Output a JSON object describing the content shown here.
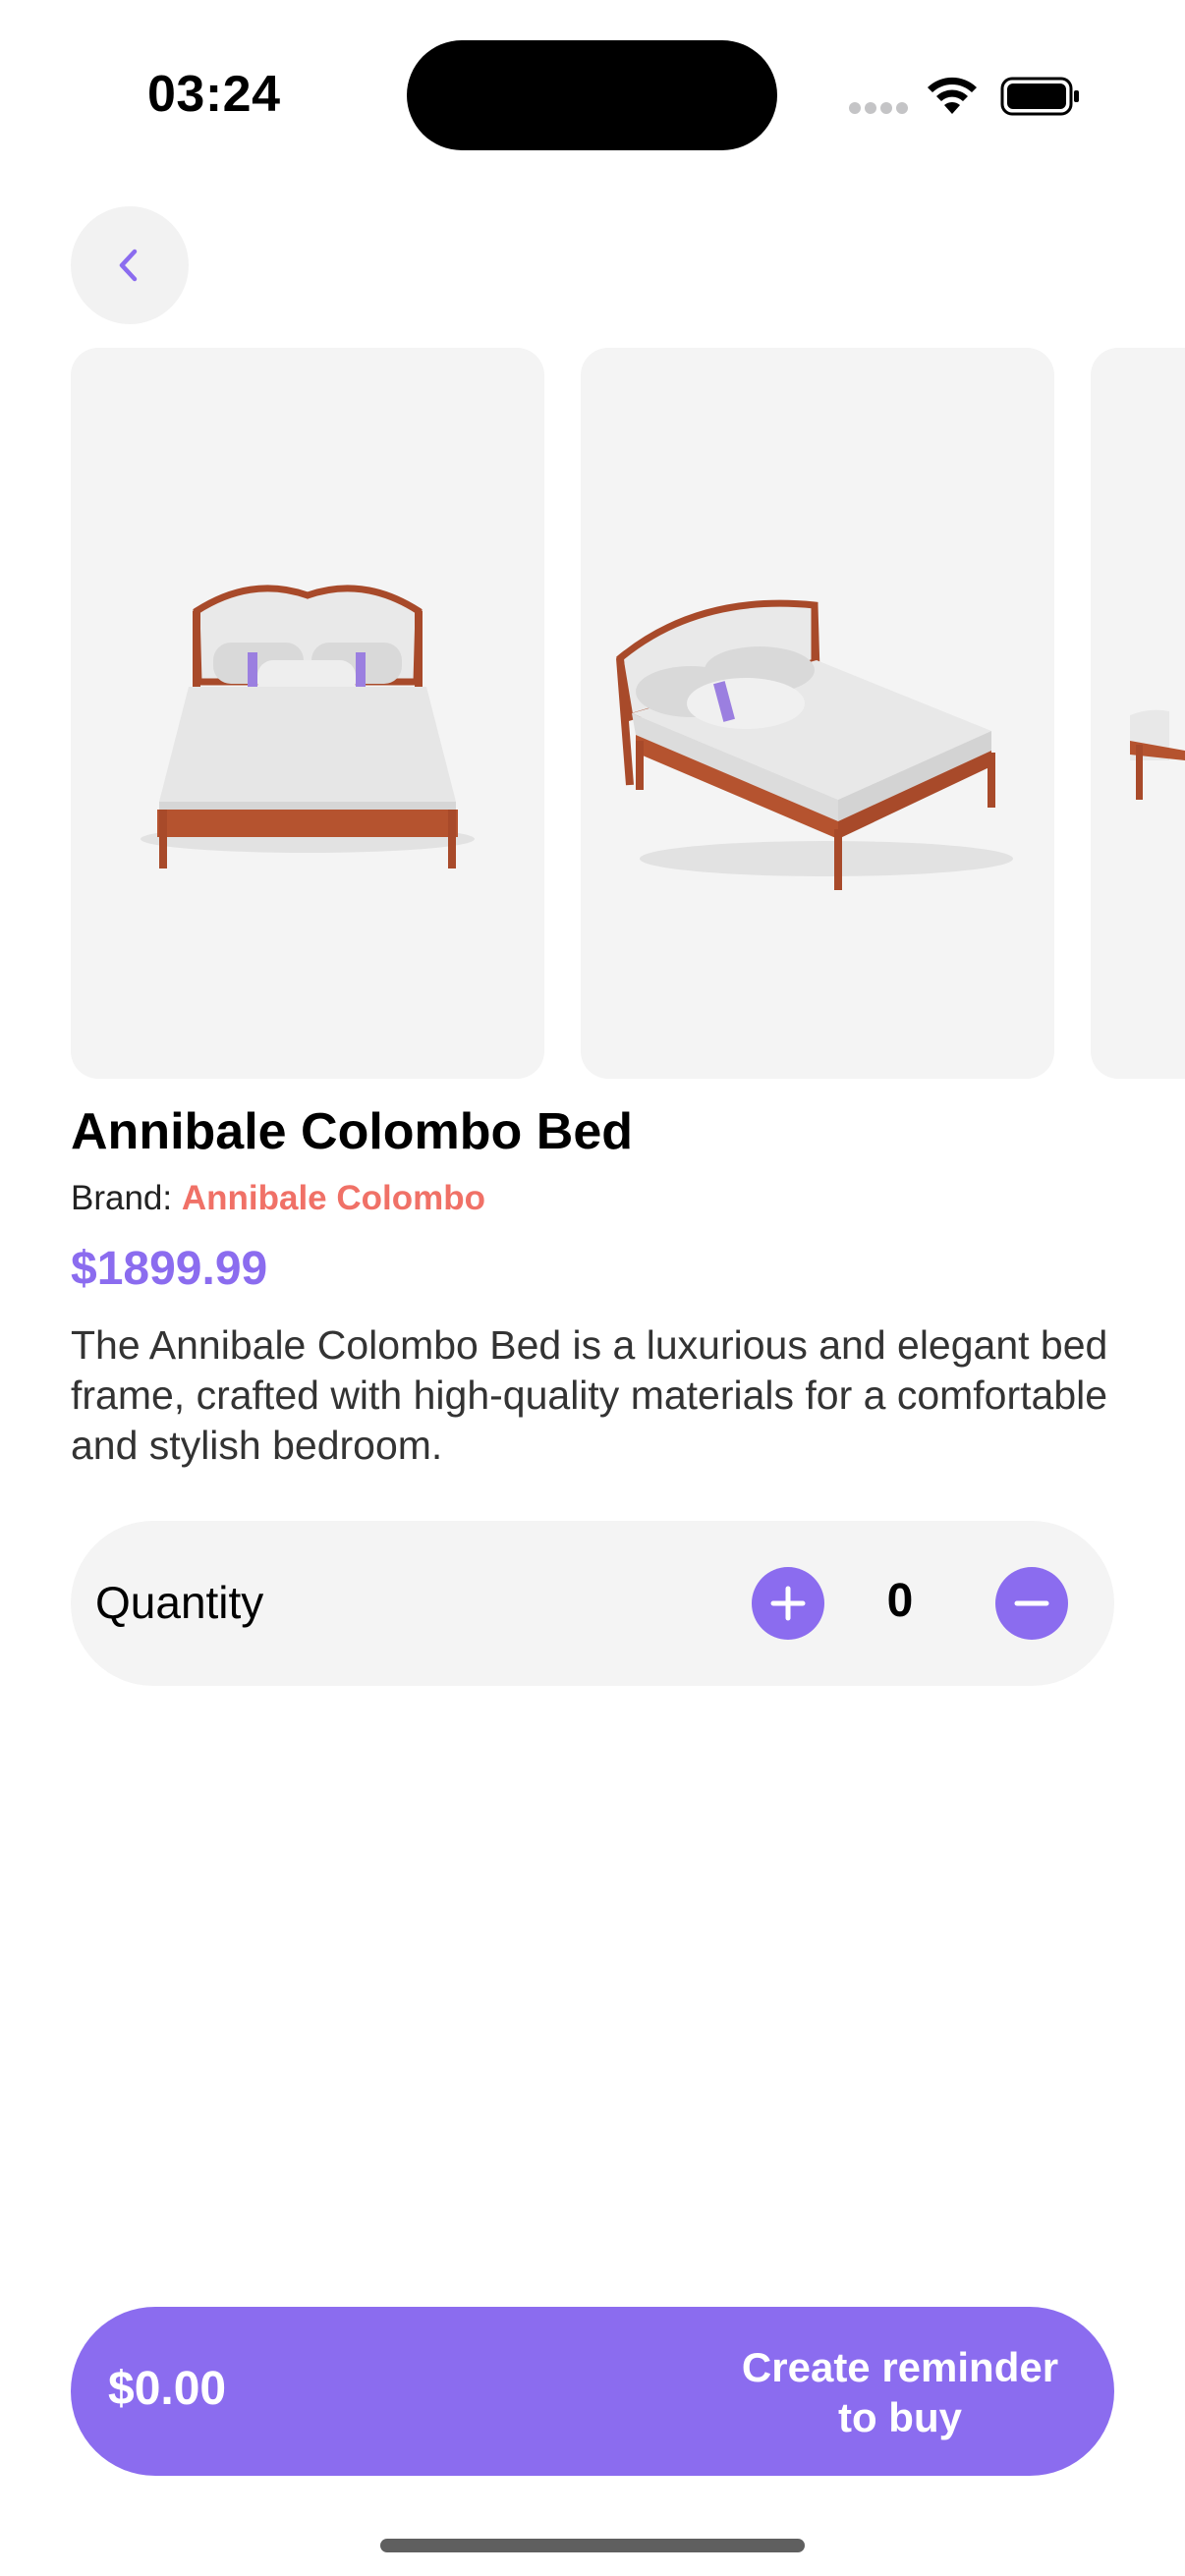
{
  "status_bar": {
    "time": "03:24",
    "icons": [
      "signal-dots-icon",
      "wifi-icon",
      "battery-icon"
    ]
  },
  "navigation": {
    "back_icon": "chevron-left-icon"
  },
  "gallery": {
    "images": [
      "bed-front-view",
      "bed-angle-view",
      "bed-side-view"
    ]
  },
  "product": {
    "title": "Annibale Colombo Bed",
    "brand_label": "Brand:",
    "brand_name": "Annibale Colombo",
    "price": "$1899.99",
    "description": "The Annibale Colombo Bed is a luxurious and elegant bed frame, crafted with high-quality materials for a comfortable and stylish bedroom."
  },
  "quantity": {
    "label": "Quantity",
    "value": "0",
    "plus_icon": "plus-icon",
    "minus_icon": "minus-icon"
  },
  "cta": {
    "total": "$0.00",
    "label": "Create reminder to buy"
  },
  "colors": {
    "accent": "#8b6cef",
    "brand": "#f07167",
    "surface": "#f4f4f4"
  }
}
